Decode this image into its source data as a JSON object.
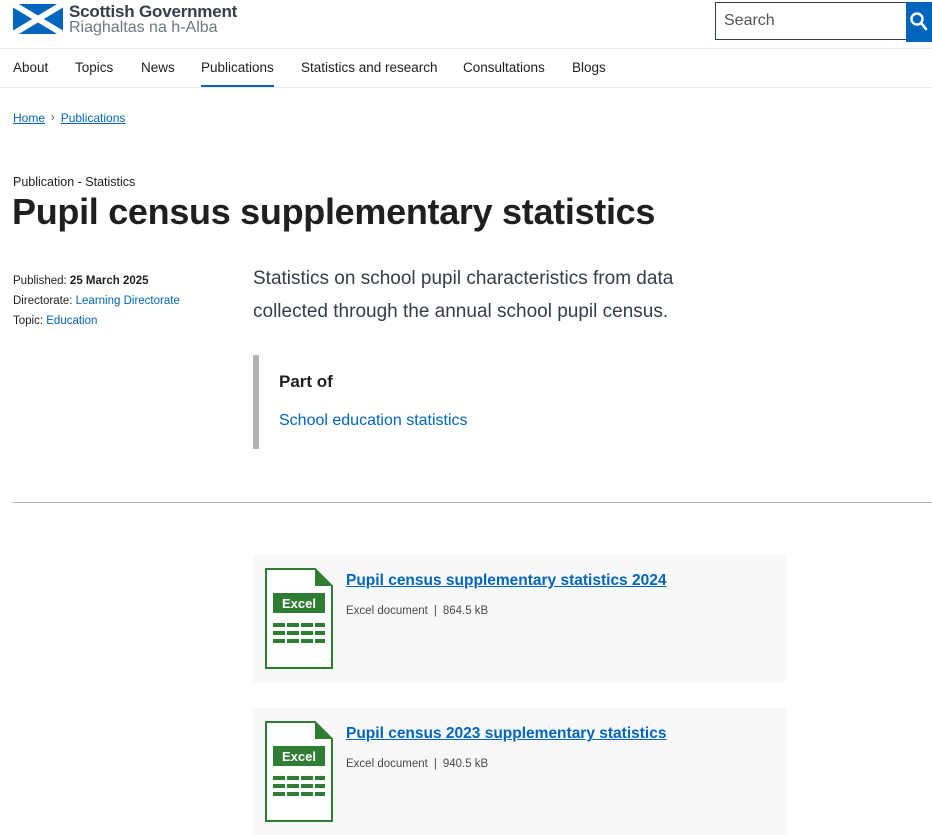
{
  "site": {
    "name": "Scottish Government",
    "gaelic_name": "Riaghaltas na h-Alba"
  },
  "search": {
    "placeholder": "Search",
    "value": ""
  },
  "nav": [
    {
      "label": "About",
      "active": false
    },
    {
      "label": "Topics",
      "active": false
    },
    {
      "label": "News",
      "active": false
    },
    {
      "label": "Publications",
      "active": true
    },
    {
      "label": "Statistics and research",
      "active": false
    },
    {
      "label": "Consultations",
      "active": false
    },
    {
      "label": "Blogs",
      "active": false
    }
  ],
  "breadcrumb": [
    {
      "label": "Home"
    },
    {
      "label": "Publications"
    }
  ],
  "page": {
    "kicker": "Publication - Statistics",
    "title": "Pupil census supplementary statistics",
    "summary": "Statistics on school pupil characteristics from data collected through the annual school pupil census."
  },
  "metadata": {
    "published_label": "Published:",
    "published_value": "25 March 2025",
    "directorate_label": "Directorate:",
    "directorate_value": "Learning Directorate",
    "topic_label": "Topic:",
    "topic_value": "Education"
  },
  "part_of": {
    "heading": "Part of",
    "link": "School education statistics"
  },
  "documents": [
    {
      "title": "Pupil census supplementary statistics 2024",
      "type": "Excel document",
      "size": "864.5 kB",
      "icon_label": "Excel"
    },
    {
      "title": "Pupil census 2023 supplementary statistics",
      "type": "Excel document",
      "size": "940.5 kB",
      "icon_label": "Excel"
    }
  ],
  "colors": {
    "link": "#0065bd",
    "excel_green": "#2e7d32",
    "doc_bg": "#f8f8f8",
    "partof_border": "#b3b3b3"
  },
  "icons": {
    "flag": "saltire-flag-icon",
    "search": "search-icon",
    "document": "excel-file-icon"
  }
}
